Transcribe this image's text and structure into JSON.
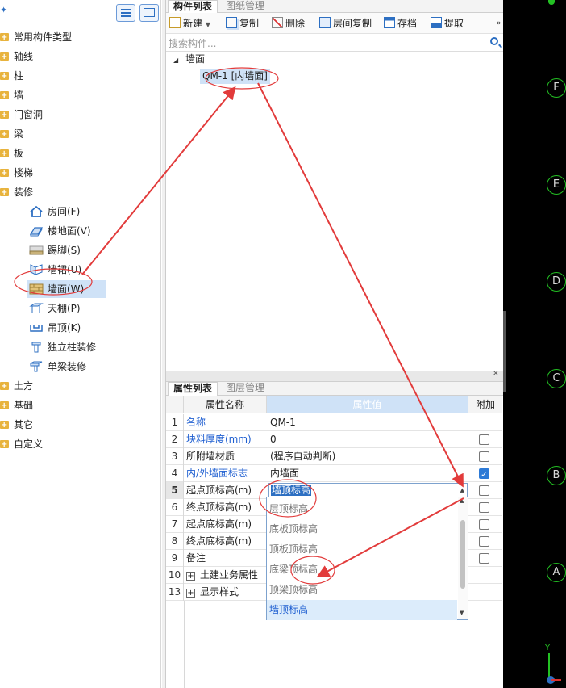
{
  "left_panel": {
    "groups": [
      "常用构件类型",
      "轴线",
      "柱",
      "墙",
      "门窗洞",
      "梁",
      "板",
      "楼梯",
      "装修",
      "土方",
      "基础",
      "其它",
      "自定义"
    ],
    "sub_items": [
      "房间(F)",
      "楼地面(V)",
      "踢脚(S)",
      "墙裙(U)",
      "墙面(W)",
      "天棚(P)",
      "吊顶(K)",
      "独立柱装修",
      "单梁装修"
    ]
  },
  "middle_panel": {
    "tabs": [
      "构件列表",
      "图纸管理"
    ],
    "toolbar": {
      "new": "新建",
      "copy": "复制",
      "delete": "删除",
      "floor_copy": "层间复制",
      "archive": "存档",
      "extract": "提取"
    },
    "search_placeholder": "搜索构件...",
    "tree": {
      "root": "墙面",
      "child": "QM-1 [内墙面]"
    }
  },
  "properties": {
    "tabs": [
      "属性列表",
      "图层管理"
    ],
    "headers": {
      "name": "属性名称",
      "value": "属性值",
      "extra": "附加"
    },
    "rows": [
      {
        "num": "1",
        "name": "名称",
        "value": "QM-1"
      },
      {
        "num": "2",
        "name": "块料厚度(mm)",
        "value": "0"
      },
      {
        "num": "3",
        "name": "所附墙材质",
        "value": "(程序自动判断)"
      },
      {
        "num": "4",
        "name": "内/外墙面标志",
        "value": "内墙面"
      },
      {
        "num": "5",
        "name": "起点顶标高(m)",
        "value": "墙顶标高"
      },
      {
        "num": "6",
        "name": "终点顶标高(m)",
        "value": ""
      },
      {
        "num": "7",
        "name": "起点底标高(m)",
        "value": ""
      },
      {
        "num": "8",
        "name": "终点底标高(m)",
        "value": ""
      },
      {
        "num": "9",
        "name": "备注",
        "value": ""
      },
      {
        "num": "10",
        "name": "土建业务属性",
        "value": ""
      },
      {
        "num": "13",
        "name": "显示样式",
        "value": ""
      }
    ],
    "dropdown_options": [
      "层顶标高",
      "底板顶标高",
      "顶板顶标高",
      "底梁顶标高",
      "顶梁顶标高",
      "墙顶标高"
    ],
    "colors": {
      "link_text": "#1f5fd1",
      "selected_bg": "#dcecfb",
      "header_bg": "#cfe2f7",
      "annotation": "#e23b3b"
    }
  },
  "canvas": {
    "axis_labels": [
      "F",
      "E",
      "D",
      "C",
      "B",
      "A"
    ],
    "ucs": {
      "y": "Y"
    }
  }
}
